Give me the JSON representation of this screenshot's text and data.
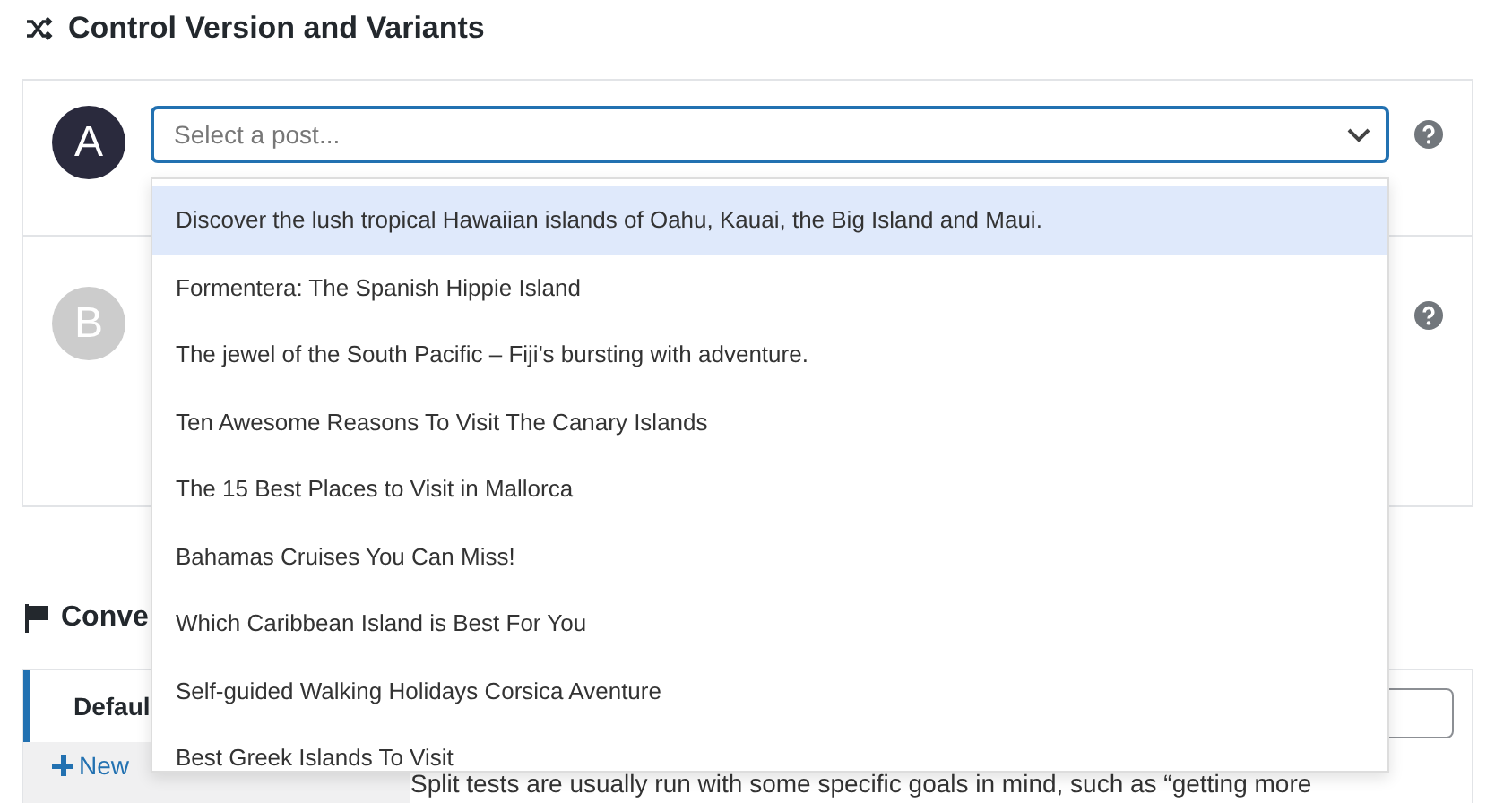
{
  "section_title": "Control Version and Variants",
  "variants": [
    {
      "letter": "A",
      "active": true,
      "placeholder": "Select a post...",
      "open": true
    },
    {
      "letter": "B",
      "active": false
    }
  ],
  "dropdown_options": [
    {
      "label": "Discover the lush tropical Hawaiian islands of Oahu, Kauai, the Big Island and Maui.",
      "selected": true
    },
    {
      "label": "Formentera: The Spanish Hippie Island",
      "selected": false
    },
    {
      "label": "The jewel of the South Pacific – Fiji's bursting with adventure.",
      "selected": false
    },
    {
      "label": "Ten Awesome Reasons To Visit The Canary Islands",
      "selected": false
    },
    {
      "label": "The 15 Best Places to Visit in Mallorca",
      "selected": false
    },
    {
      "label": "Bahamas Cruises You Can Miss!",
      "selected": false
    },
    {
      "label": "Which Caribbean Island is Best For You",
      "selected": false
    },
    {
      "label": "Self-guided Walking Holidays Corsica Aventure",
      "selected": false
    },
    {
      "label": "Best Greek Islands To Visit",
      "selected": false
    }
  ],
  "conversion": {
    "title": "Conve",
    "goals": [
      {
        "label": "Defaul",
        "selected": true
      }
    ],
    "new_button": "New",
    "description": "Split tests are usually run with some specific goals in mind, such as “getting more"
  }
}
